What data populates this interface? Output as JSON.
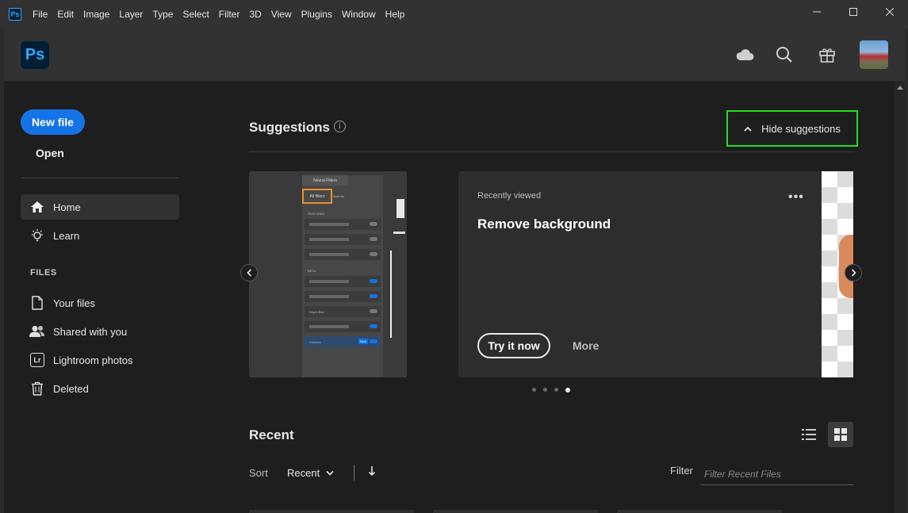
{
  "menubar": {
    "app_icon_text": "Ps",
    "items": [
      "File",
      "Edit",
      "Image",
      "Layer",
      "Type",
      "Select",
      "Filter",
      "3D",
      "View",
      "Plugins",
      "Window",
      "Help"
    ]
  },
  "header": {
    "logo_text": "Ps",
    "icons": [
      "cloud-icon",
      "search-icon",
      "gift-icon",
      "avatar"
    ]
  },
  "sidebar": {
    "new_file": "New file",
    "open": "Open",
    "nav": [
      {
        "label": "Home",
        "icon": "home-icon",
        "active": true
      },
      {
        "label": "Learn",
        "icon": "lightbulb-icon",
        "active": false
      }
    ],
    "files_heading": "FILES",
    "files": [
      {
        "label": "Your files",
        "icon": "file-icon"
      },
      {
        "label": "Shared with you",
        "icon": "people-icon"
      },
      {
        "label": "Lightroom photos",
        "icon": "lightroom-icon",
        "icon_text": "Lr"
      },
      {
        "label": "Deleted",
        "icon": "trash-icon"
      }
    ]
  },
  "suggestions": {
    "title": "Suggestions",
    "info": "i",
    "hide_label": "Hide suggestions",
    "card": {
      "eyebrow": "Recently viewed",
      "title": "Remove background",
      "more_menu": "•••",
      "primary": "Try it now",
      "secondary": "More"
    },
    "neural": {
      "header": "Neural Filters",
      "tab_all": "All filters",
      "tab_wait": "Wait list",
      "featured": "FEATURED",
      "beta": "BETA",
      "depth_blur": "Depth Blur",
      "colorize": "Colorize",
      "new_badge": "New"
    },
    "pager": {
      "count": 4,
      "active": 3
    }
  },
  "recent": {
    "title": "Recent",
    "sort_label": "Sort",
    "sort_value": "Recent",
    "filter_label": "Filter",
    "filter_placeholder": "Filter Recent Files"
  }
}
